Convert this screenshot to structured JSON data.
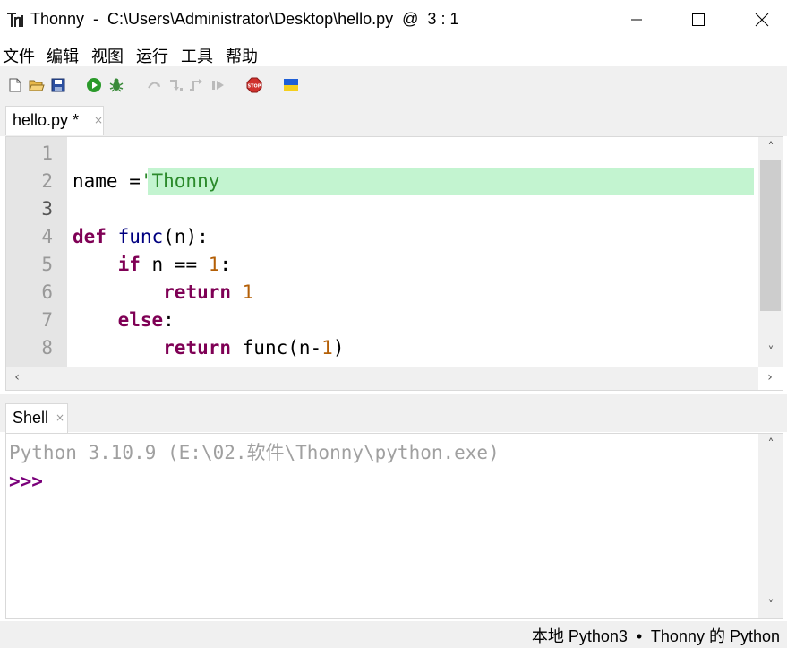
{
  "window": {
    "title": "Thonny  -  C:\\Users\\Administrator\\Desktop\\hello.py  @  3 : 1"
  },
  "menu": [
    "文件",
    "编辑",
    "视图",
    "运行",
    "工具",
    "帮助"
  ],
  "toolbar": {
    "icons": [
      "new-file-icon",
      "open-file-icon",
      "save-icon",
      "run-icon",
      "debug-icon",
      "step-over-icon",
      "step-into-icon",
      "step-out-icon",
      "resume-icon",
      "stop-icon",
      "ukraine-flag-icon"
    ]
  },
  "editor": {
    "tab_label": "hello.py *",
    "tab_close": "×",
    "line_numbers": [
      "1",
      "2",
      "3",
      "4",
      "5",
      "6",
      "7",
      "8"
    ],
    "lines": {
      "l2_a": "name =",
      "l2_b": "'Thonny",
      "l4_kw": "def",
      "l4_fn": "func",
      "l4_rest": "(n):",
      "l5_kw": "if",
      "l5_mid": " n == ",
      "l5_num": "1",
      "l5_end": ":",
      "l6_kw": "return",
      "l6_num": "1",
      "l7_kw": "else",
      "l7_end": ":",
      "l8_kw": "return",
      "l8_mid": " func(n-",
      "l8_num": "1",
      "l8_end": ")"
    },
    "current_line": 3
  },
  "shell": {
    "tab_label": "Shell",
    "tab_close": "×",
    "banner": "Python 3.10.9 (E:\\02.软件\\Thonny\\python.exe)",
    "prompt": ">>>"
  },
  "status": {
    "text": "本地 Python3  •  Thonny 的 Python"
  },
  "colors": {
    "keyword": "#7f0055",
    "function": "#000080",
    "number": "#b45f06",
    "string": "#2b8a2b",
    "string_highlight": "#c3f4d0",
    "prompt": "#7a007a"
  }
}
